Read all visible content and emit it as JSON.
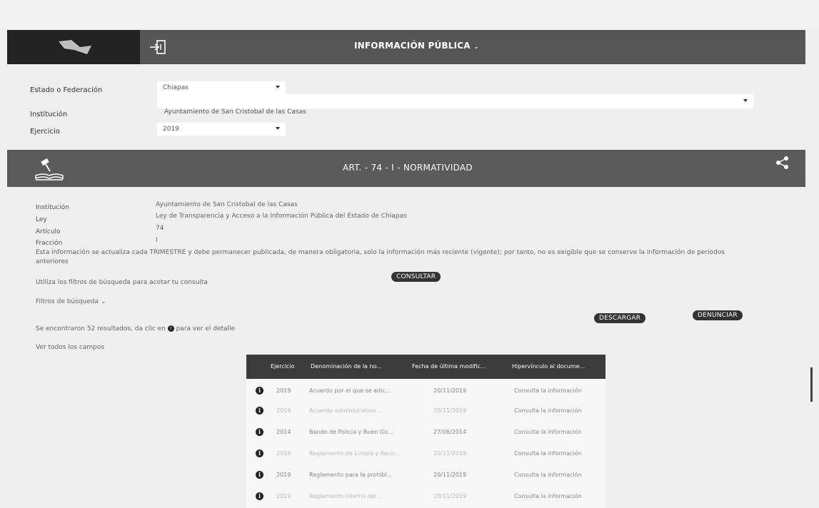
{
  "header": {
    "title": "INFORMACIÓN PÚBLICA",
    "login_icon": "login-icon",
    "chevron_icon": "chevron-down-icon"
  },
  "filters": {
    "estado_label": "Estado o Federación",
    "estado_value": "Chiapas",
    "institucion_label": "Institución",
    "institucion_value": "Ayuntamiento de San Cristobal de las Casas",
    "ejercicio_label": "Ejercicio",
    "ejercicio_value": "2019"
  },
  "article": {
    "title": "ART. - 74 - I - NORMATIVIDAD",
    "share_icon": "share-icon"
  },
  "info": {
    "institucion_label": "Institución",
    "institucion_value": "Ayuntamiento de San Cristobal de las Casas",
    "ley_label": "Ley",
    "ley_value": "Ley de Transparencia y Acceso a la Información Pública del Estado de Chiapas",
    "articulo_label": "Artículo",
    "articulo_value": "74",
    "fraccion_label": "Fracción",
    "fraccion_value": "I",
    "note": "Esta información se actualiza cada TRIMESTRE y debe permanecer publicada, de manera obligatoria, solo la información más reciente (vigente); por tanto, no es exigible que se conserve la información de periodos anteriores"
  },
  "actions": {
    "filters_hint": "Utiliza los filtros de búsqueda para acotar tu consulta",
    "consultar": "CONSULTAR",
    "filtros_busqueda": "Filtros de búsqueda",
    "descargar": "DESCARGAR",
    "denunciar": "DENUNCIAR",
    "results_pre": "Se encontraron 52 resultados, da clic en",
    "results_post": "para ver el detalle",
    "ver_todos": "Ver todos los campos"
  },
  "table": {
    "headers": [
      "Ejercicio",
      "Denominación de la no...",
      "Fecha de última modific...",
      "Hipervínculo al docume..."
    ],
    "rows": [
      {
        "ejercicio": "2019",
        "denominacion": "Acuerdo por el que se adic...",
        "fecha": "20/11/2019",
        "link": "Consulta la información"
      },
      {
        "ejercicio": "2019",
        "denominacion": "Acuerdo administrativo ...",
        "fecha": "20/11/2019",
        "link": "Consulta la información"
      },
      {
        "ejercicio": "2014",
        "denominacion": "Bando de Policía y Buen Go...",
        "fecha": "27/06/2014",
        "link": "Consulta la información"
      },
      {
        "ejercicio": "2019",
        "denominacion": "Reglamento de Limpia y Reco...",
        "fecha": "20/11/2019",
        "link": "Consulta la información"
      },
      {
        "ejercicio": "2019",
        "denominacion": "Reglamento para la prohibi...",
        "fecha": "20/11/2019",
        "link": "Consulta la información"
      },
      {
        "ejercicio": "2019",
        "denominacion": "Reglamento interno del ...",
        "fecha": "20/11/2019",
        "link": "Consulta la información"
      }
    ]
  }
}
